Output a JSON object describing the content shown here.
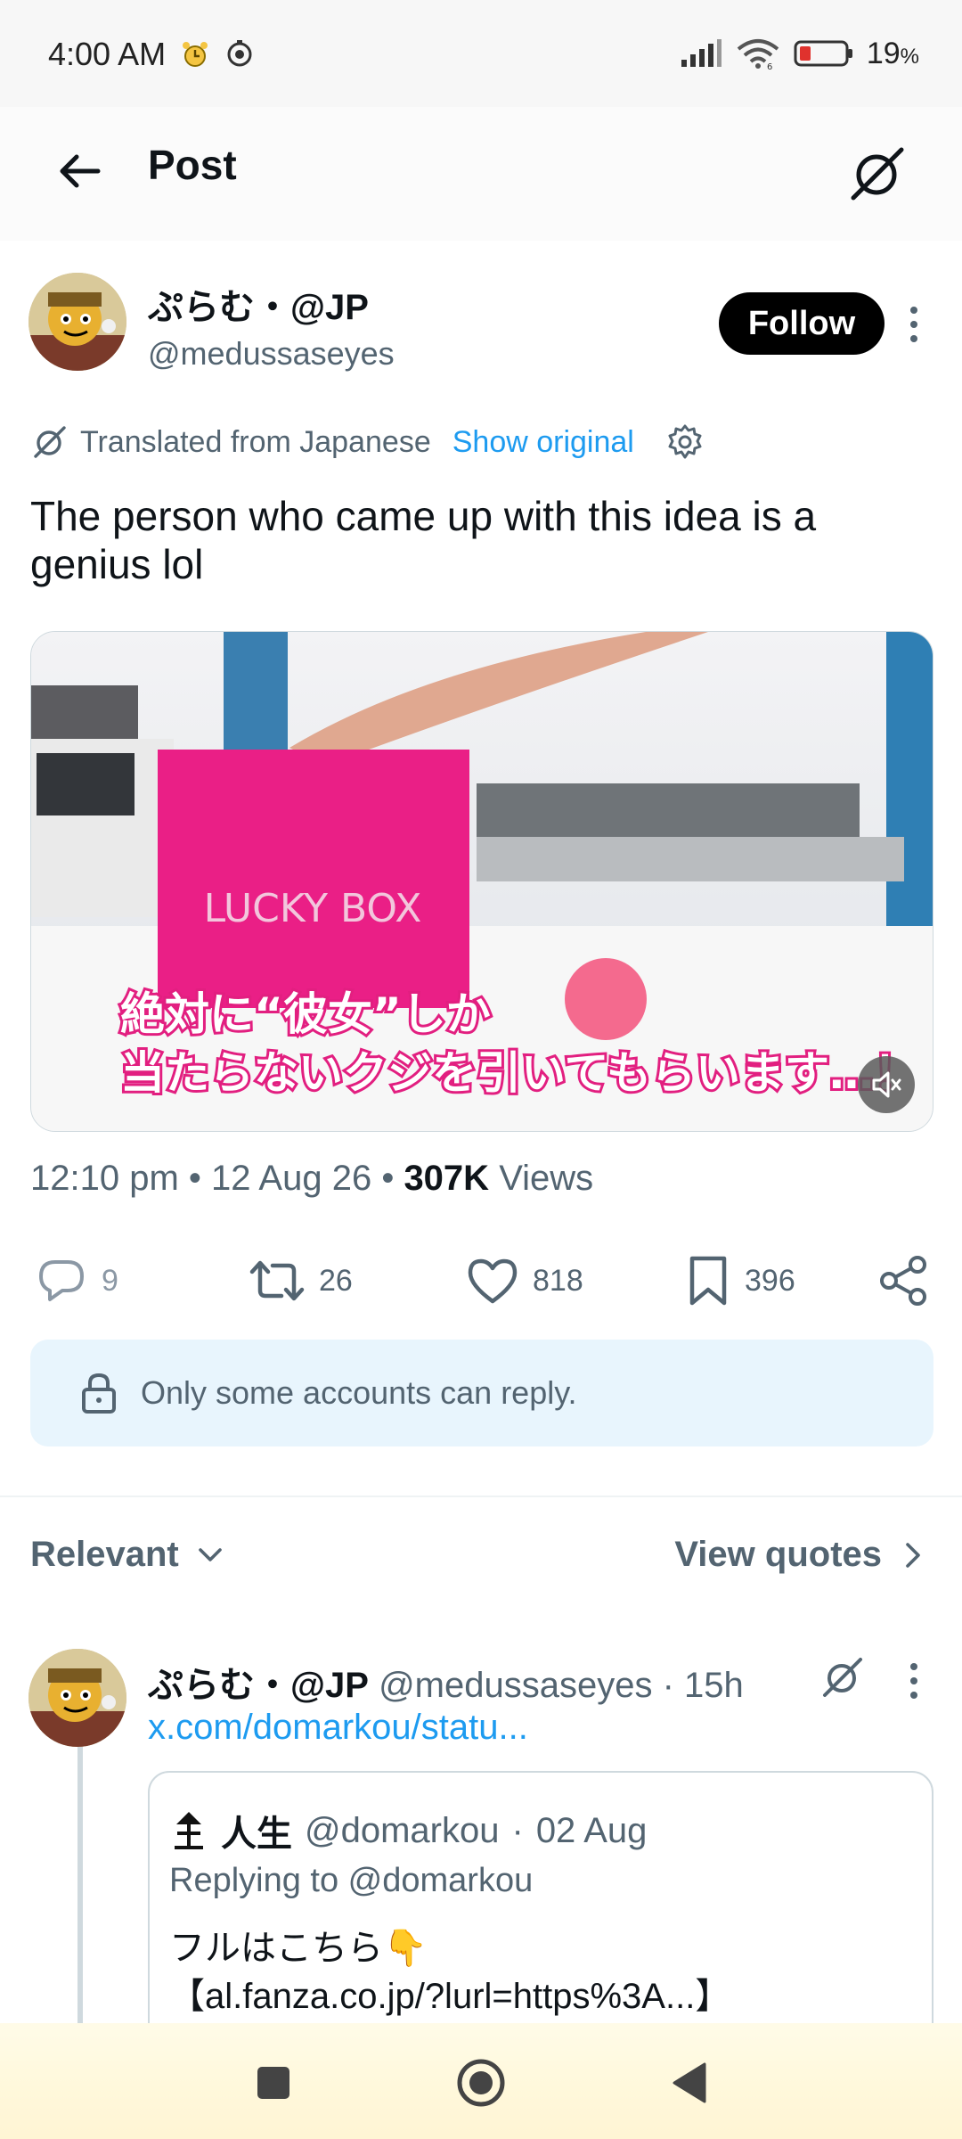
{
  "status_bar": {
    "time": "4:00 AM",
    "battery": "19",
    "battery_unit": "%",
    "signal_label": "4G 6"
  },
  "header": {
    "title": "Post"
  },
  "post": {
    "author_name": "ぷらむ・@JP",
    "author_handle": "@medussaseyes",
    "follow_label": "Follow",
    "translated_label": "Translated from Japanese",
    "show_original_label": "Show original",
    "text": "The person who came up with this idea is a genius lol",
    "media": {
      "box_label": "LUCKY BOX",
      "caption_line1": "絶対に“彼女”しか",
      "caption_line2": "当たらないクジを引いてもらいます…！"
    },
    "time": "12:10 pm",
    "date": "12 Aug 26",
    "views_count": "307K",
    "views_label": "Views",
    "stats": {
      "replies": "9",
      "reposts": "26",
      "likes": "818",
      "bookmarks": "396"
    },
    "reply_restriction": "Only some accounts can reply."
  },
  "sort": {
    "label": "Relevant",
    "view_quotes_label": "View quotes"
  },
  "reply": {
    "author_name": "ぷらむ・@JP",
    "author_handle": "@medussaseyes",
    "age": "15h",
    "link": "x.com/domarkou/statu...",
    "quote": {
      "author_name": "人生",
      "author_handle": "@domarkou",
      "date": "02 Aug",
      "replying_to": "Replying to @domarkou",
      "line1": "フルはこちら👇",
      "line2": "【al.fanza.co.jp/?lurl=https%3A...】"
    }
  },
  "colors": {
    "accent": "#1d9bf0",
    "text_primary": "#0f1419",
    "text_secondary": "#536471",
    "reply_note_bg": "#e8f5fd"
  }
}
